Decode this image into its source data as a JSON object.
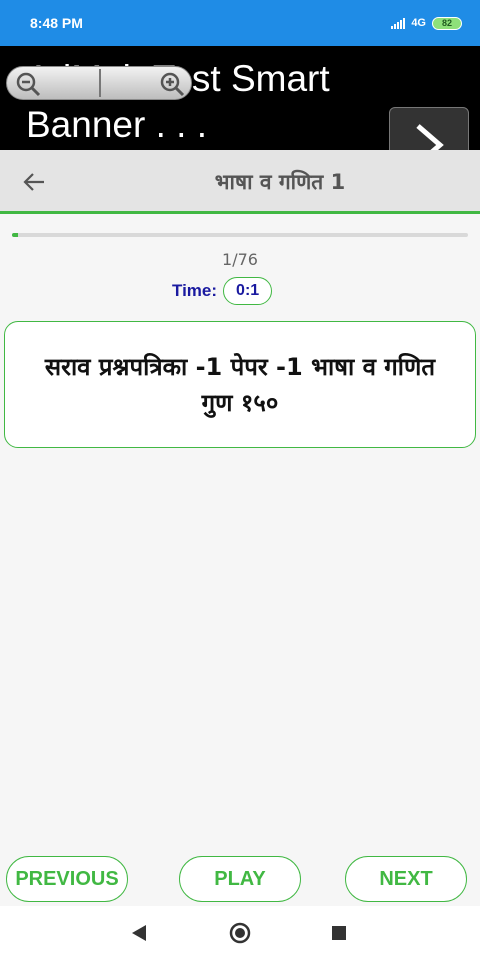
{
  "status_bar": {
    "time": "8:48 PM",
    "network": "4G",
    "battery": "82"
  },
  "ad_banner": {
    "text": "AdMob Test Smart Banner . . .",
    "icons": [
      "zoom-out-icon",
      "zoom-in-icon",
      "chevron-right-icon"
    ]
  },
  "app_bar": {
    "title": "भाषा व गणित 1",
    "back_icon": "arrow-left-icon"
  },
  "quiz": {
    "progress": 0.013,
    "counter": "1/76",
    "timer_label": "Time:",
    "timer_value": "0:1",
    "question": "सराव प्रश्नपत्रिका -1 पेपर -1 भाषा व गणित गुण १५०"
  },
  "buttons": {
    "previous": "PREVIOUS",
    "play": "PLAY",
    "next": "NEXT"
  },
  "colors": {
    "status_bar": "#1f8ce6",
    "accent_green": "#41b843",
    "timer_blue": "#1a1aa0"
  }
}
